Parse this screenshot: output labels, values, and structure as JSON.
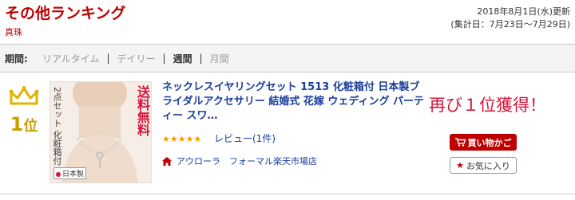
{
  "header": {
    "title": "その他ランキング",
    "category": "真珠",
    "updated_line1": "2018年8月1日(水)更新",
    "updated_line2": "(集計日：7月23日〜7月29日)"
  },
  "period": {
    "label": "期間:",
    "items": [
      {
        "label": "リアルタイム",
        "active": false
      },
      {
        "label": "デイリー",
        "active": false
      },
      {
        "label": "週間",
        "active": true
      },
      {
        "label": "月間",
        "active": false
      }
    ],
    "separator": "|"
  },
  "item": {
    "rank_number": "1",
    "rank_suffix": "位",
    "thumbnail": {
      "ribbon_text": "送料無料",
      "vertical_text": "2点セット 化粧箱付",
      "flag_text": "日本製"
    },
    "title": "ネックレスイヤリングセット 1513 化粧箱付 日本製ブライダルアクセサリー 結婚式 花嫁 ウェディング パーティー スワ…",
    "stars": "★★★★★",
    "review_label": "レビュー(1件)",
    "shop_name": "アウローラ　フォーマル楽天市場店",
    "callout": "再び１位獲得！",
    "cart_label": "買い物かご",
    "favorite_label": "お気に入り"
  },
  "colors": {
    "brand_red": "#bf0000",
    "link_blue": "#1a3d9c",
    "gold": "#c8a000",
    "callout_red": "#d5153c"
  },
  "icons": [
    "crown-icon",
    "home-icon",
    "cart-icon",
    "star-icon"
  ]
}
